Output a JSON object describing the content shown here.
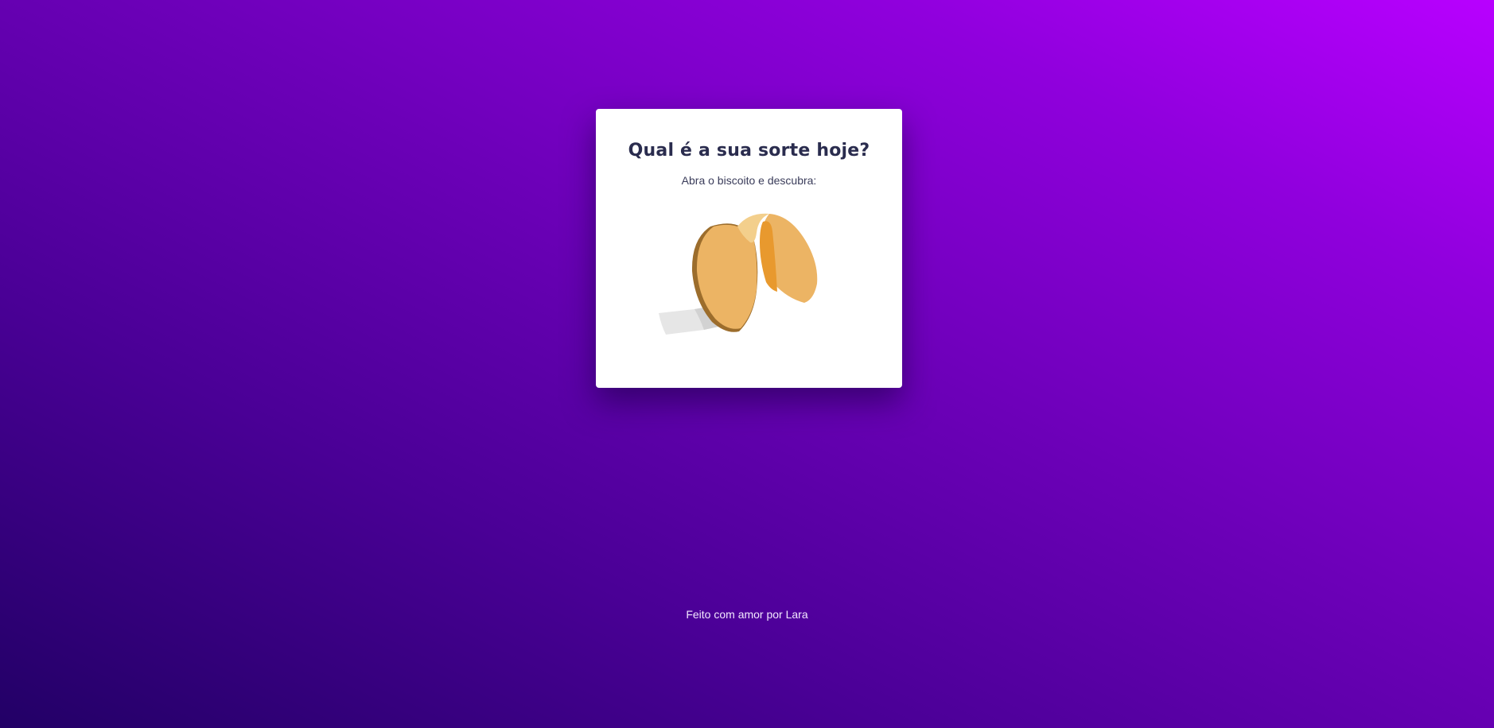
{
  "card": {
    "title": "Qual é a sua sorte hoje?",
    "subtitle": "Abra o biscoito e descubra:",
    "image": {
      "icon": "fortune-cookie-icon"
    }
  },
  "footer": {
    "text": "Feito com amor por Lara"
  },
  "colors": {
    "background_start": "#220066",
    "background_end": "#b800ff",
    "card": "#ffffff",
    "title": "#2a2c4e",
    "cookie": "#ecb464",
    "cookie_shadow": "#e8992e"
  }
}
